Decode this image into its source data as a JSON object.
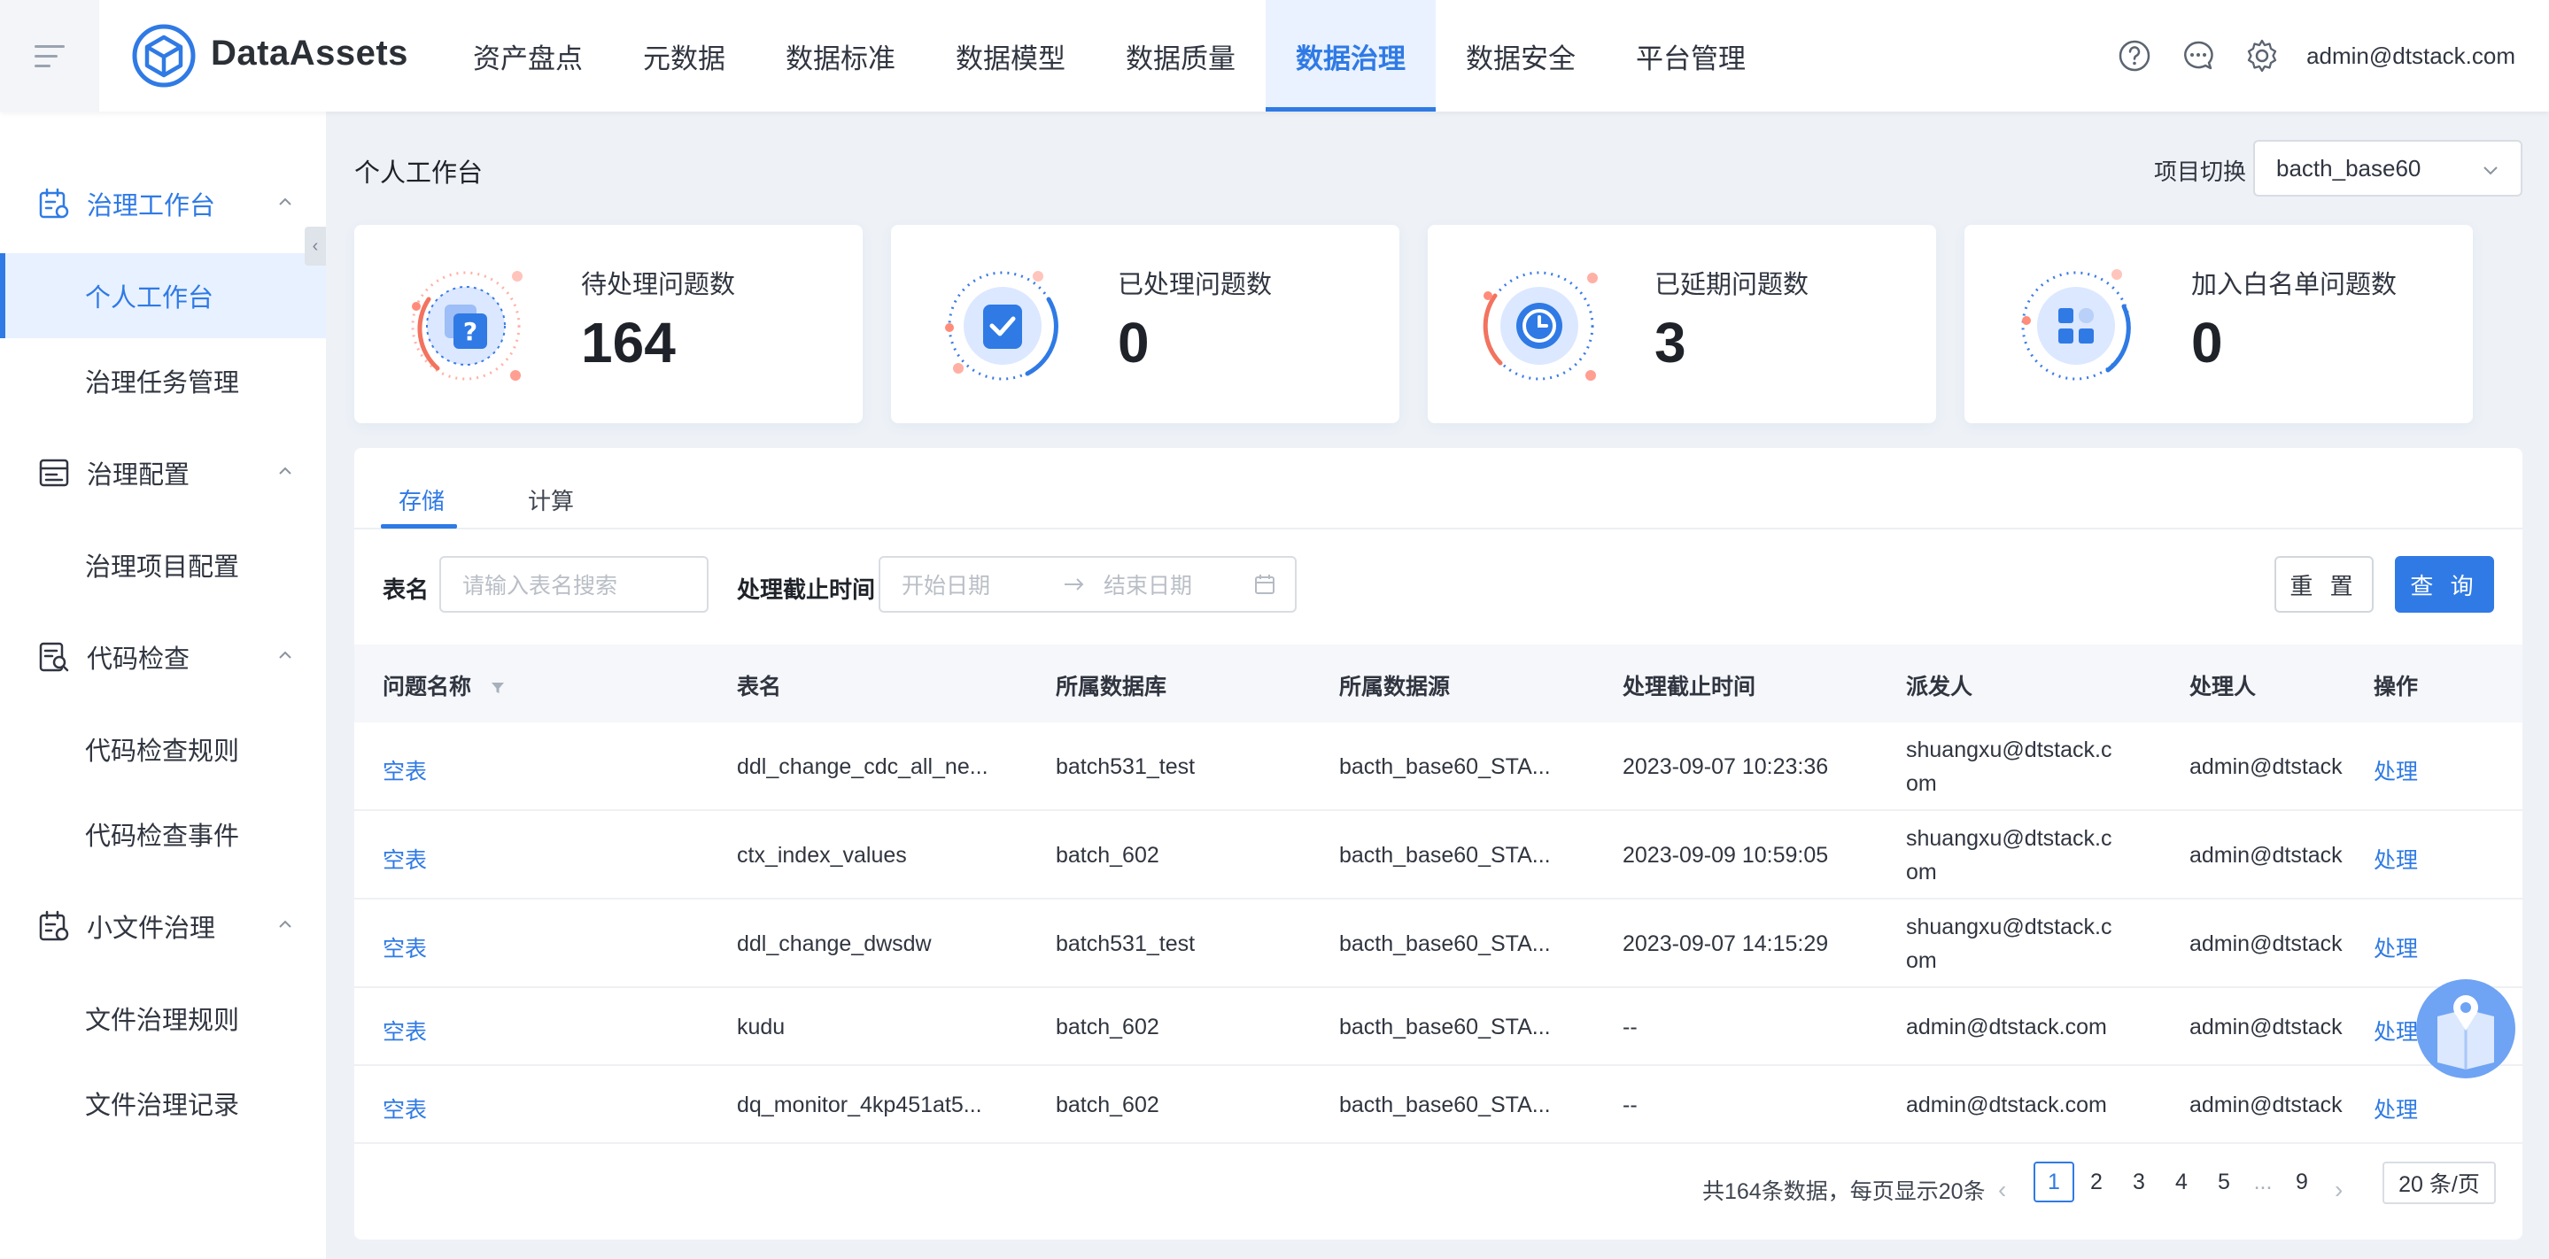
{
  "header": {
    "brand": "DataAssets",
    "nav": [
      "资产盘点",
      "元数据",
      "数据标准",
      "数据模型",
      "数据质量",
      "数据治理",
      "数据安全",
      "平台管理"
    ],
    "active_nav": "数据治理",
    "user": "admin@dtstack.com",
    "icons": [
      "help-icon",
      "message-icon",
      "settings-icon"
    ]
  },
  "sidebar": {
    "groups": [
      {
        "label": "治理工作台",
        "icon": "workbench-icon",
        "items": [
          "个人工作台",
          "治理任务管理"
        ]
      },
      {
        "label": "治理配置",
        "icon": "config-icon",
        "items": [
          "治理项目配置"
        ]
      },
      {
        "label": "代码检查",
        "icon": "code-check-icon",
        "items": [
          "代码检查规则",
          "代码检查事件"
        ]
      },
      {
        "label": "小文件治理",
        "icon": "file-governance-icon",
        "items": [
          "文件治理规则",
          "文件治理记录"
        ]
      }
    ],
    "active_item": "个人工作台"
  },
  "page": {
    "title": "个人工作台",
    "project_label": "项目切换",
    "project_value": "bacth_base60"
  },
  "stats": [
    {
      "label": "待处理问题数",
      "value": "164",
      "icon": "question-icon"
    },
    {
      "label": "已处理问题数",
      "value": "0",
      "icon": "check-icon"
    },
    {
      "label": "已延期问题数",
      "value": "3",
      "icon": "clock-icon"
    },
    {
      "label": "加入白名单问题数",
      "value": "0",
      "icon": "grid-icon"
    }
  ],
  "tabs": [
    "存储",
    "计算"
  ],
  "active_tab": "存储",
  "filters": {
    "table_label": "表名",
    "table_placeholder": "请输入表名搜索",
    "deadline_label": "处理截止时间",
    "start_placeholder": "开始日期",
    "end_placeholder": "结束日期",
    "reset": "重 置",
    "query": "查 询"
  },
  "table": {
    "columns": [
      "问题名称",
      "表名",
      "所属数据库",
      "所属数据源",
      "处理截止时间",
      "派发人",
      "处理人",
      "操作"
    ],
    "rows": [
      {
        "issue": "空表",
        "table": "ddl_change_cdc_all_ne...",
        "db": "batch531_test",
        "source": "bacth_base60_STA...",
        "deadline": "2023-09-07 10:23:36",
        "assigner": "shuangxu@dtstack.com",
        "handler": "admin@dtstack",
        "action": "处理"
      },
      {
        "issue": "空表",
        "table": "ctx_index_values",
        "db": "batch_602",
        "source": "bacth_base60_STA...",
        "deadline": "2023-09-09 10:59:05",
        "assigner": "shuangxu@dtstack.com",
        "handler": "admin@dtstack",
        "action": "处理"
      },
      {
        "issue": "空表",
        "table": "ddl_change_dwsdw",
        "db": "batch531_test",
        "source": "bacth_base60_STA...",
        "deadline": "2023-09-07 14:15:29",
        "assigner": "shuangxu@dtstack.com",
        "handler": "admin@dtstack",
        "action": "处理"
      },
      {
        "issue": "空表",
        "table": "kudu",
        "db": "batch_602",
        "source": "bacth_base60_STA...",
        "deadline": "--",
        "assigner": "admin@dtstack.com",
        "handler": "admin@dtstack",
        "action": "处理"
      },
      {
        "issue": "空表",
        "table": "dq_monitor_4kp451at5...",
        "db": "batch_602",
        "source": "bacth_base60_STA...",
        "deadline": "--",
        "assigner": "admin@dtstack.com",
        "handler": "admin@dtstack",
        "action": "处理"
      }
    ]
  },
  "pagination": {
    "total_text": "共164条数据，每页显示20条",
    "pages": [
      "1",
      "2",
      "3",
      "4",
      "5",
      "...",
      "9"
    ],
    "current": "1",
    "page_size": "20 条/页"
  },
  "colors": {
    "accent": "#2f7ae5",
    "nav_active_bg": "#eaf2ff",
    "background": "#eef2f7"
  }
}
